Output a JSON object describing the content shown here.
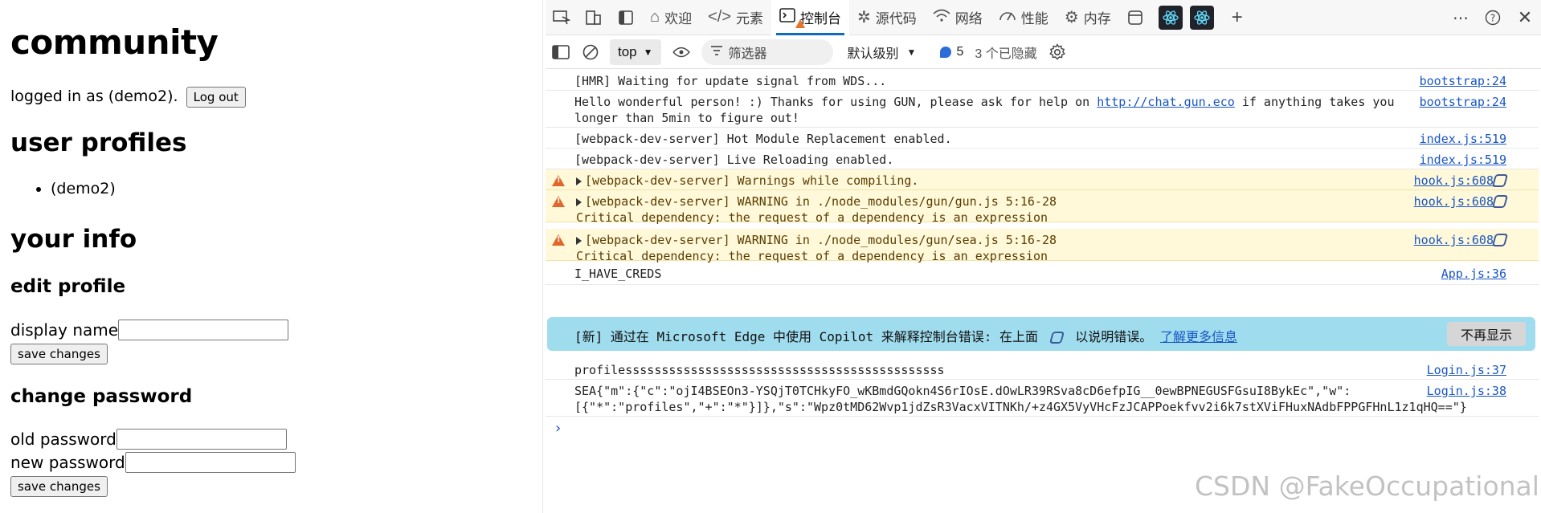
{
  "page": {
    "title": "community",
    "logged_in_text": "logged in as (demo2).",
    "logout_label": "Log out",
    "profiles_heading": "user profiles",
    "profiles": [
      "(demo2)"
    ],
    "your_info_heading": "your info",
    "edit_profile_heading": "edit profile",
    "display_name_label": "display name",
    "display_name_value": "",
    "save_changes_label": "save changes",
    "change_password_heading": "change password",
    "old_password_label": "old password",
    "new_password_label": "new password"
  },
  "devtools": {
    "tabs": [
      {
        "label": "欢迎",
        "icon": "home-icon"
      },
      {
        "label": "元素",
        "icon": "code-icon"
      },
      {
        "label": "控制台",
        "icon": "console-icon"
      },
      {
        "label": "源代码",
        "icon": "bug-icon"
      },
      {
        "label": "网络",
        "icon": "wifi-icon"
      },
      {
        "label": "性能",
        "icon": "gauge-icon"
      },
      {
        "label": "内存",
        "icon": "chip-icon"
      }
    ],
    "toolbar": {
      "context": "top",
      "filter_placeholder": "筛选器",
      "levels": "默认级别",
      "issues_count": "5",
      "hidden_count": "3 个已隐藏"
    },
    "messages": [
      {
        "type": "log",
        "text": "[HMR] Waiting for update signal from WDS...",
        "source": "bootstrap:24"
      },
      {
        "type": "log",
        "text_a": "Hello wonderful person! :) Thanks for using GUN, please ask for help on ",
        "link": "http://chat.gun.eco",
        "text_b": " if anything takes you",
        "text_c": "longer than 5min to figure out!",
        "source": "bootstrap:24"
      },
      {
        "type": "log",
        "text": "[webpack-dev-server] Hot Module Replacement enabled.",
        "source": "index.js:519"
      },
      {
        "type": "log",
        "text": "[webpack-dev-server] Live Reloading enabled.",
        "source": "index.js:519"
      },
      {
        "type": "warn",
        "text": "[webpack-dev-server] Warnings while compiling.",
        "source": "hook.js:608"
      },
      {
        "type": "warn",
        "text": "[webpack-dev-server] WARNING in ./node_modules/gun/gun.js 5:16-28",
        "text2": "Critical dependency: the request of a dependency is an expression",
        "source": "hook.js:608"
      },
      {
        "type": "warn",
        "text": "[webpack-dev-server] WARNING in ./node_modules/gun/sea.js 5:16-28",
        "text2": "Critical dependency: the request of a dependency is an expression",
        "source": "hook.js:608"
      },
      {
        "type": "log",
        "text": "I_HAVE_CREDS",
        "source": "App.js:36"
      },
      {
        "type": "log",
        "text": "profilessssssssssssssssssssssssssssssssssssssssssss",
        "source": "Login.js:37"
      },
      {
        "type": "log",
        "text": "SEA{\"m\":{\"c\":\"ojI4BSEOn3-YSQjT0TCHkyFO_wKBmdGQokn4S6rIOsE.dOwLR39RSva8cD6efpIG__0ewBPNEGUSFGsuI8BykEc\",\"w\":",
        "text2": "[{\"*\":\"profiles\",\"+\":\"*\"}]},\"s\":\"Wpz0tMD62Wvp1jdZsR3VacxVITNKh/+z4GX5VyVHcFzJCAPPoekfvv2i6k7stXViFHuxNAdbFPPGFHnL1z1qHQ==\"}",
        "source": "Login.js:38"
      }
    ],
    "banner": {
      "text": "[新] 通过在 Microsoft Edge 中使用 Copilot 来解释控制台错误: 在上面",
      "text_after": "以说明错误。",
      "link": "了解更多信息",
      "dismiss": "不再显示"
    },
    "prompt": "›"
  },
  "watermark": "CSDN @FakeOccupational"
}
